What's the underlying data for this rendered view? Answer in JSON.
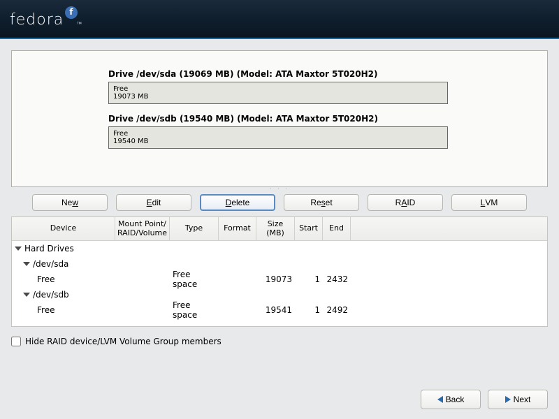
{
  "logo": {
    "text": "fedora"
  },
  "drives": [
    {
      "title": "Drive /dev/sda (19069 MB) (Model: ATA Maxtor 5T020H2)",
      "free_label": "Free",
      "free_size": "19073 MB"
    },
    {
      "title": "Drive /dev/sdb (19540 MB) (Model: ATA Maxtor 5T020H2)",
      "free_label": "Free",
      "free_size": "19540 MB"
    }
  ],
  "buttons": {
    "new": "New",
    "new_ul": "w",
    "edit": "Edit",
    "edit_ul": "E",
    "delete": "Delete",
    "delete_ul": "D",
    "reset": "Reset",
    "reset_ul": "s",
    "raid": "RAID",
    "raid_ul": "A",
    "lvm": "LVM",
    "lvm_ul": "L"
  },
  "table": {
    "headers": {
      "device": "Device",
      "mount": "Mount Point/\nRAID/Volume",
      "type": "Type",
      "format": "Format",
      "size": "Size\n(MB)",
      "start": "Start",
      "end": "End"
    },
    "root_label": "Hard Drives",
    "rows": [
      {
        "device": "/dev/sda",
        "children": [
          {
            "device": "Free",
            "type": "Free space",
            "size": "19073",
            "start": "1",
            "end": "2432"
          }
        ]
      },
      {
        "device": "/dev/sdb",
        "children": [
          {
            "device": "Free",
            "type": "Free space",
            "size": "19541",
            "start": "1",
            "end": "2492"
          }
        ]
      }
    ]
  },
  "hide_raid_label_pre": "Hide RAID device/LVM Volume ",
  "hide_raid_label_ul": "G",
  "hide_raid_label_post": "roup members",
  "nav": {
    "back": "Back",
    "back_ul": "B",
    "next": "Next",
    "next_ul": "N"
  }
}
